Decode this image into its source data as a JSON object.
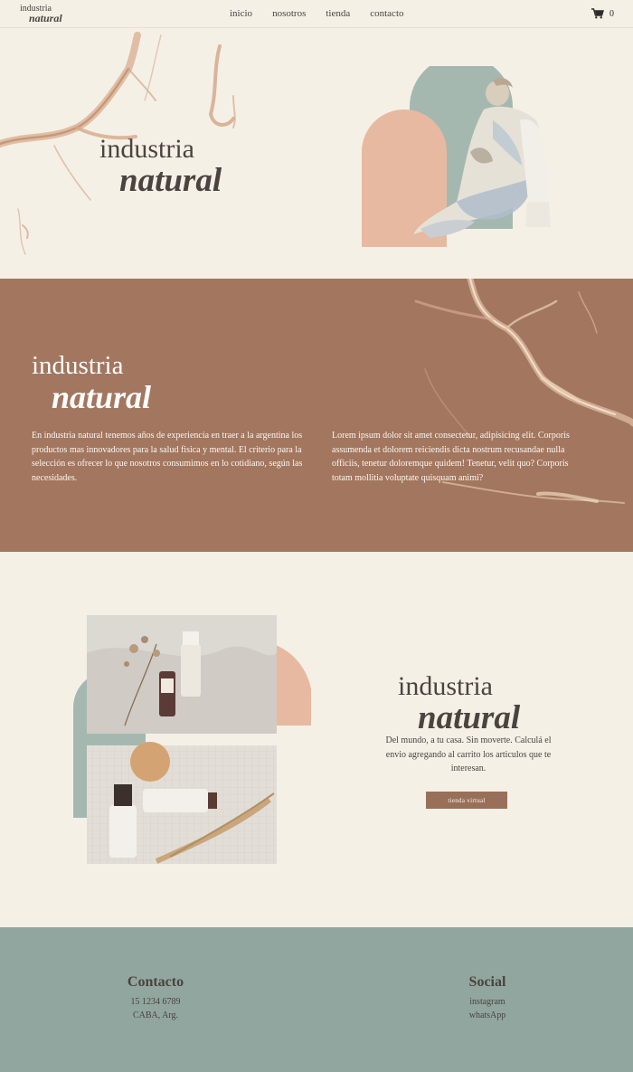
{
  "nav": {
    "logo": {
      "line1": "industria",
      "line2": "natural"
    },
    "links": [
      {
        "label": "inicio"
      },
      {
        "label": "nosotros"
      },
      {
        "label": "tienda"
      },
      {
        "label": "contacto"
      }
    ],
    "cart_count": "0",
    "cart_icon": "shopping-cart-icon"
  },
  "hero": {
    "title_line1": "industria",
    "title_line2": "natural"
  },
  "about": {
    "title_line1": "industria",
    "title_line2": "natural",
    "paragraph_left": "En industria natural tenemos años de experiencia en traer a la argentina los productos mas innovadores para la salud fisica y mental. El criterio para la selección es ofrecer lo que nosotros consumimos en lo cotidiano, según las necesidades.",
    "paragraph_right": "Lorem ipsum dolor sit amet consectetur, adipisicing elit. Corporis assumenda et dolorem reiciendis dicta nostrum recusandae nulla officiis, tenetur doloremque quidem! Tenetur, velit quo? Corporis totam mollitia voluptate quisquam animi?"
  },
  "shop": {
    "title_line1": "industria",
    "title_line2": "natural",
    "text": "Del mundo, a tu casa. Sin moverte. Calculá el envio agregando al carrito los articulos que te interesan.",
    "button_label": "tienda virtual"
  },
  "footer": {
    "contact": {
      "heading": "Contacto",
      "phone": "15 1234 6789",
      "location": "CABA, Arg."
    },
    "social": {
      "heading": "Social",
      "links": [
        {
          "label": "instagram"
        },
        {
          "label": "whatsApp"
        }
      ]
    }
  },
  "colors": {
    "background": "#f5f0e6",
    "accent_brown": "#a2765f",
    "sage": "#91a69f",
    "peach": "#e7b9a0",
    "text": "#4a4340"
  }
}
